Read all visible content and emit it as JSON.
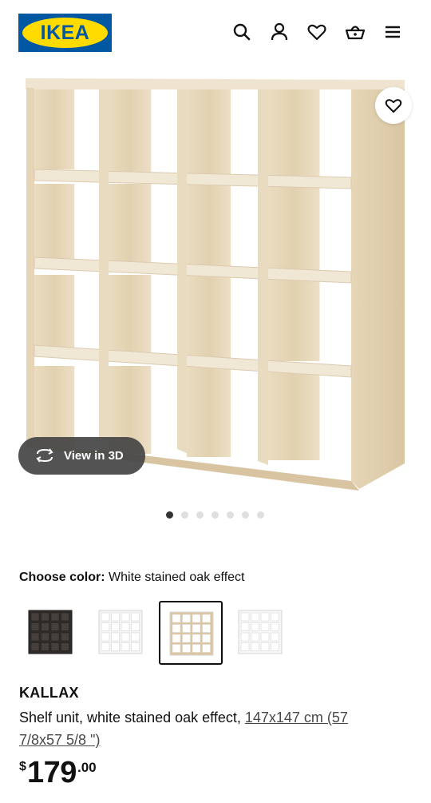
{
  "header": {
    "logo_text": "IKEA",
    "icons": [
      "search-icon",
      "account-icon",
      "heart-icon",
      "basket-icon",
      "menu-icon"
    ]
  },
  "gallery": {
    "view3d_label": "View in 3D",
    "image_count": 7,
    "active_index": 0
  },
  "color_choice": {
    "label": "Choose color:",
    "selected": "White stained oak effect",
    "options": [
      "black-brown",
      "white",
      "white stained oak effect",
      "high-gloss white"
    ],
    "selected_index": 2
  },
  "product": {
    "name": "KALLAX",
    "desc_prefix": "Shelf unit, white stained oak effect, ",
    "dimensions": "147x147 cm (57 7/8x57 5/8 \")",
    "currency": "$",
    "price_int": "179",
    "price_dec": ".00"
  },
  "colors": {
    "ikea_blue": "#0058a3",
    "ikea_yellow": "#ffdb00",
    "oak": "#e8d9bd",
    "pill_bg": "#444444"
  }
}
